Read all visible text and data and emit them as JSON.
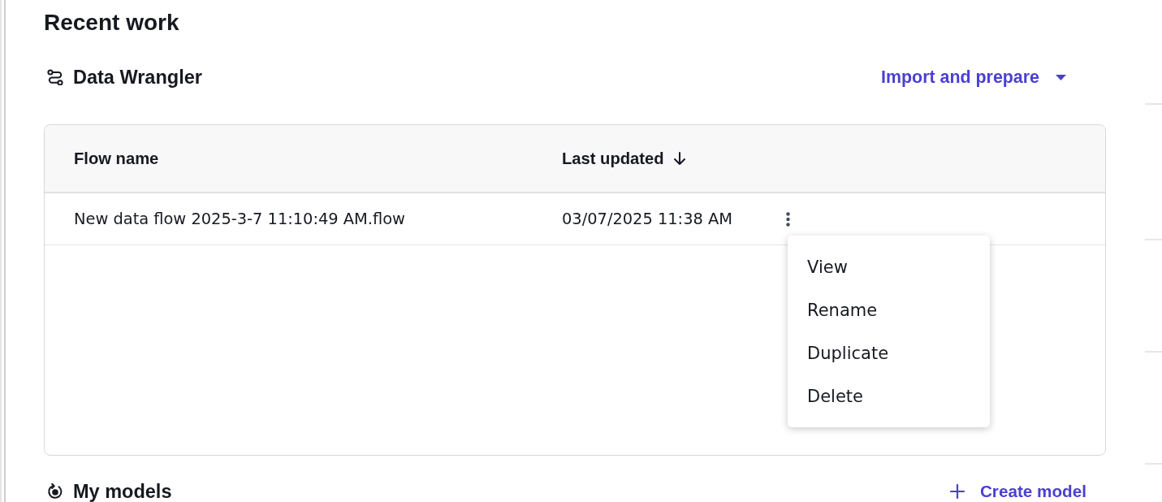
{
  "page": {
    "title": "Recent work"
  },
  "data_wrangler": {
    "title": "Data Wrangler",
    "action": {
      "label": "Import and prepare"
    },
    "table": {
      "columns": [
        {
          "label": "Flow name",
          "sorted": false
        },
        {
          "label": "Last updated",
          "sorted": true
        }
      ],
      "rows": [
        {
          "cells": [
            "New data flow 2025-3-7 11:10:49 AM.flow",
            "03/07/2025 11:38 AM"
          ],
          "menu": {
            "open": true,
            "items": [
              "View",
              "Rename",
              "Duplicate",
              "Delete"
            ]
          }
        }
      ]
    }
  },
  "my_models": {
    "title": "My models",
    "action": {
      "label": "Create model"
    }
  }
}
